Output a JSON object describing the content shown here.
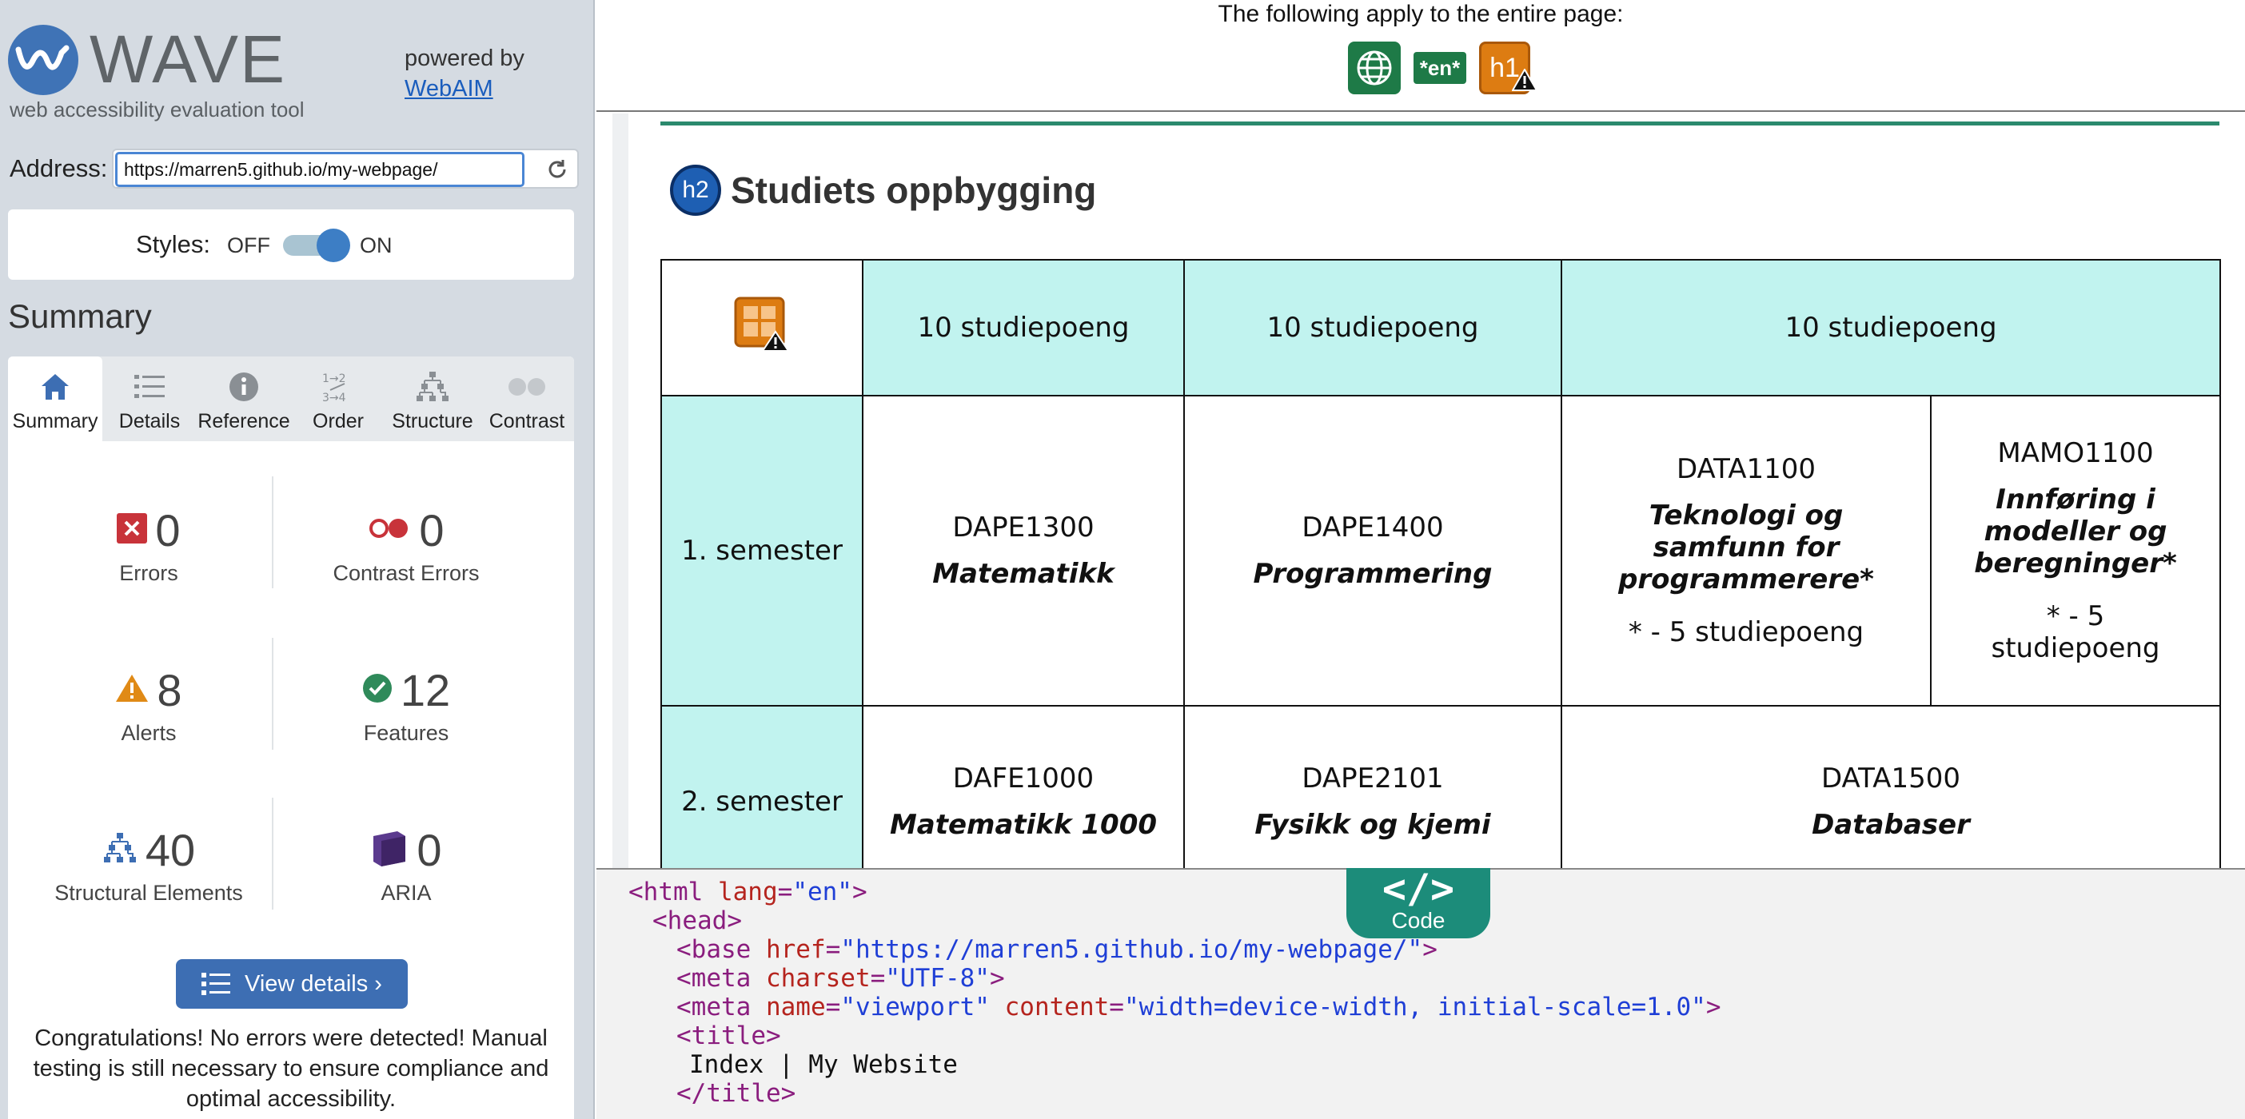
{
  "sidebar": {
    "brand": "WAVE",
    "tagline": "web accessibility evaluation tool",
    "powered_by": "powered by",
    "webaim_link": "WebAIM",
    "address_label": "Address:",
    "address_value": "https://marren5.github.io/my-webpage/",
    "styles_label": "Styles:",
    "styles_off": "OFF",
    "styles_on": "ON",
    "styles_enabled": true,
    "summary_title": "Summary",
    "tabs": [
      {
        "label": "Summary",
        "icon": "home-icon",
        "active": true
      },
      {
        "label": "Details",
        "icon": "list-icon",
        "active": false
      },
      {
        "label": "Reference",
        "icon": "info-icon",
        "active": false
      },
      {
        "label": "Order",
        "icon": "order-icon",
        "active": false
      },
      {
        "label": "Structure",
        "icon": "structure-icon",
        "active": false
      },
      {
        "label": "Contrast",
        "icon": "contrast-icon",
        "active": false
      }
    ],
    "stats": {
      "errors": {
        "count": "0",
        "label": "Errors"
      },
      "contrast_errors": {
        "count": "0",
        "label": "Contrast Errors"
      },
      "alerts": {
        "count": "8",
        "label": "Alerts"
      },
      "features": {
        "count": "12",
        "label": "Features"
      },
      "structural": {
        "count": "40",
        "label": "Structural Elements"
      },
      "aria": {
        "count": "0",
        "label": "ARIA"
      }
    },
    "view_details": "View details ›",
    "congrats": "Congratulations! No errors were detected! Manual testing is still necessary to ensure compliance and optimal accessibility."
  },
  "page_banner": {
    "text": "The following apply to the entire page:",
    "en_badge": "*en*",
    "h1_badge": "h1"
  },
  "content": {
    "h2_badge": "h2",
    "heading": "Studiets oppbygging",
    "table": {
      "header": [
        "10 studiepoeng",
        "10 studiepoeng",
        "10 studiepoeng"
      ],
      "sem1": {
        "label": "1. semester",
        "c1_code": "DAPE1300",
        "c1_name": "Matematikk",
        "c2_code": "DAPE1400",
        "c2_name": "Programmering",
        "c3_code": "DATA1100",
        "c3_name": "Teknologi og samfunn for programmerere*",
        "c3_note": "* - 5 studiepoeng",
        "c4_code": "MAMO1100",
        "c4_name": "Innføring i modeller og beregninger*",
        "c4_note": "* - 5 studiepoeng"
      },
      "sem2": {
        "label": "2. semester",
        "c1_code": "DAFE1000",
        "c1_name": "Matematikk 1000",
        "c2_code": "DAPE2101",
        "c2_name": "Fysikk og kjemi",
        "c3_code": "DATA1500",
        "c3_name": "Databaser"
      }
    }
  },
  "code_pane": {
    "tab_symbol": "</>",
    "tab_label": "Code",
    "l1_open": "<html ",
    "l1_attr": "lang",
    "l1_eq": "=",
    "l1_val": "\"en\"",
    "l1_close": ">",
    "l2": "<head>",
    "l3_open": "<base ",
    "l3_attr": "href",
    "l3_eq": "=",
    "l3_val": "\"https://marren5.github.io/my-webpage/\"",
    "l3_close": ">",
    "l4_open": "<meta ",
    "l4_attr": "charset",
    "l4_eq": "=",
    "l4_val": "\"UTF-8\"",
    "l4_close": ">",
    "l5_open": "<meta ",
    "l5_attr1": "name",
    "l5_eq1": "=",
    "l5_val1": "\"viewport\"",
    "l5_sp": " ",
    "l5_attr2": "content",
    "l5_eq2": "=",
    "l5_val2": "\"width=device-width, initial-scale=1.0\"",
    "l5_close": ">",
    "l6": "<title>",
    "l7": "Index | My Website",
    "l8": "</title>"
  },
  "colors": {
    "accent_blue": "#3d6eb3",
    "header_cell": "#c1f3ef",
    "error_red": "#c8333a",
    "alert_orange": "#e08a16",
    "feature_green": "#2f8a5a",
    "aria_purple": "#5b3a8e"
  }
}
